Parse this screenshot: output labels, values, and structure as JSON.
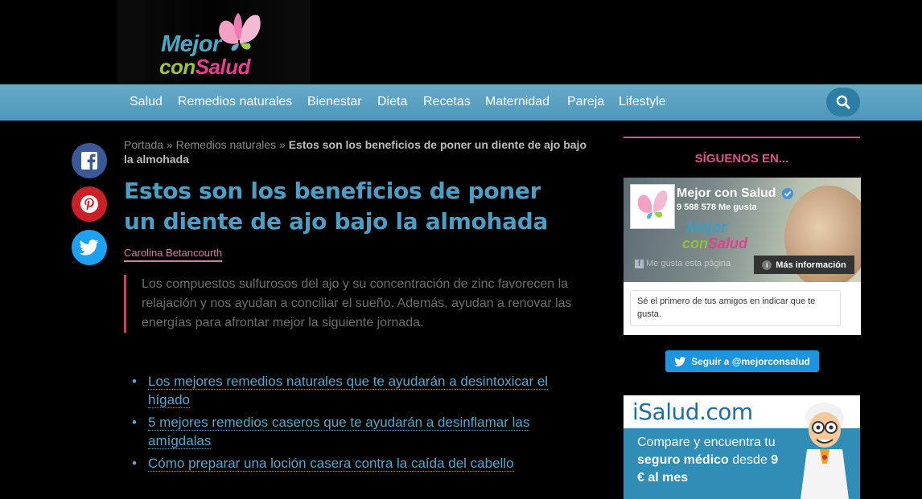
{
  "logo": {
    "mejor": "Mejor",
    "con": "con",
    "salud": "Salud"
  },
  "nav": {
    "items": [
      "Salud",
      "Remedios naturales",
      "Bienestar",
      "Dieta",
      "Recetas",
      "Maternidad",
      "Pareja",
      "Lifestyle"
    ],
    "search_icon": "search-icon"
  },
  "share": {
    "facebook": "facebook-icon",
    "pinterest": "pinterest-icon",
    "twitter": "twitter-icon",
    "colors": {
      "facebook": "#3b5998",
      "pinterest": "#cb2027",
      "twitter": "#1da1f2"
    }
  },
  "breadcrumb": {
    "home": "Portada",
    "sep1": " » ",
    "category": "Remedios naturales",
    "sep2": " » ",
    "current": "Estos son los beneficios de poner un diente de ajo bajo la almohada"
  },
  "article": {
    "title": "Estos son los beneficios de poner un diente de ajo bajo la almohada",
    "author": "Carolina Betancourth",
    "summary": "Los compuestos sulfurosos del ajo y su concentración de zinc favorecen la relajación y nos ayudan a conciliar el sueño. Además, ayudan a renovar las energías para afrontar mejor la siguiente jornada.",
    "related": [
      "Los mejores remedios naturales que te ayudarán a desintoxicar el hígado",
      "5 mejores remedios caseros que te ayudarán a desinflamar las amígdalas",
      "Cómo preparar una loción casera contra la caída del cabello"
    ]
  },
  "sidebar": {
    "follow_title": "SÍGUENOS EN...",
    "facebook": {
      "page_name": "Mejor con Salud",
      "likes": "9 588 578 Me gusta",
      "like_button": "Me gusta esta página",
      "more_info": "Más información",
      "friends_text": "Sé el primero de tus amigos en indicar que te gusta.",
      "cover_logo_mejor": "Mejor",
      "cover_logo_con": "con",
      "cover_logo_salud": "Salud"
    },
    "twitter_follow": "Seguir a @mejorconsalud",
    "ad": {
      "brand": "iSalud.com",
      "line1": "Compare y encuentra tu",
      "line2_bold": "seguro médico",
      "line2_rest": " desde ",
      "price_bold": "9",
      "line3_bold": "€ al mes"
    }
  },
  "colors": {
    "accent_blue": "#4d9ec4",
    "accent_pink": "#e0528d",
    "nav_bg": "#5aa1c2",
    "background": "#000000"
  }
}
